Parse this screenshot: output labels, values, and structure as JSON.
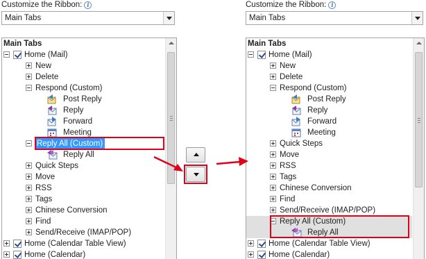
{
  "left_panel": {
    "caption": "Customize the Ribbon:",
    "info_glyph": "i",
    "combo_value": "Main Tabs",
    "list_header": "Main Tabs",
    "rows": [
      {
        "label": "Home (Mail)",
        "kind": "tab",
        "expander": "minus",
        "checked": true
      },
      {
        "label": "New",
        "kind": "group",
        "expander": "plus"
      },
      {
        "label": "Delete",
        "kind": "group",
        "expander": "plus"
      },
      {
        "label": "Respond (Custom)",
        "kind": "group",
        "expander": "minus"
      },
      {
        "label": "Post Reply",
        "kind": "command",
        "icon": "post-reply-icon"
      },
      {
        "label": "Reply",
        "kind": "command",
        "icon": "reply-icon"
      },
      {
        "label": "Forward",
        "kind": "command",
        "icon": "forward-icon"
      },
      {
        "label": "Meeting",
        "kind": "command",
        "icon": "meeting-icon"
      },
      {
        "label": "Reply All (Custom)",
        "kind": "group",
        "expander": "minus",
        "state": "selected"
      },
      {
        "label": "Reply All",
        "kind": "command",
        "icon": "reply-all-icon"
      },
      {
        "label": "Quick Steps",
        "kind": "group",
        "expander": "plus"
      },
      {
        "label": "Move",
        "kind": "group",
        "expander": "plus"
      },
      {
        "label": "RSS",
        "kind": "group",
        "expander": "plus"
      },
      {
        "label": "Tags",
        "kind": "group",
        "expander": "plus"
      },
      {
        "label": "Chinese Conversion",
        "kind": "group",
        "expander": "plus"
      },
      {
        "label": "Find",
        "kind": "group",
        "expander": "plus"
      },
      {
        "label": "Send/Receive (IMAP/POP)",
        "kind": "group",
        "expander": "plus"
      },
      {
        "label": "Home (Calendar Table View)",
        "kind": "tab",
        "expander": "plus",
        "checked": true
      },
      {
        "label": "Home (Calendar)",
        "kind": "tab",
        "expander": "plus",
        "checked": true
      }
    ]
  },
  "right_panel": {
    "caption": "Customize the Ribbon:",
    "info_glyph": "i",
    "combo_value": "Main Tabs",
    "list_header": "Main Tabs",
    "rows": [
      {
        "label": "Home (Mail)",
        "kind": "tab",
        "expander": "minus",
        "checked": true
      },
      {
        "label": "New",
        "kind": "group",
        "expander": "plus"
      },
      {
        "label": "Delete",
        "kind": "group",
        "expander": "plus"
      },
      {
        "label": "Respond (Custom)",
        "kind": "group",
        "expander": "minus"
      },
      {
        "label": "Post Reply",
        "kind": "command",
        "icon": "post-reply-icon"
      },
      {
        "label": "Reply",
        "kind": "command",
        "icon": "reply-icon"
      },
      {
        "label": "Forward",
        "kind": "command",
        "icon": "forward-icon"
      },
      {
        "label": "Meeting",
        "kind": "command",
        "icon": "meeting-icon"
      },
      {
        "label": "Quick Steps",
        "kind": "group",
        "expander": "plus"
      },
      {
        "label": "Move",
        "kind": "group",
        "expander": "plus"
      },
      {
        "label": "RSS",
        "kind": "group",
        "expander": "plus"
      },
      {
        "label": "Tags",
        "kind": "group",
        "expander": "plus"
      },
      {
        "label": "Chinese Conversion",
        "kind": "group",
        "expander": "plus"
      },
      {
        "label": "Find",
        "kind": "group",
        "expander": "plus"
      },
      {
        "label": "Send/Receive (IMAP/POP)",
        "kind": "group",
        "expander": "plus"
      },
      {
        "label": "Reply All (Custom)",
        "kind": "group",
        "expander": "minus",
        "state": "highlighted"
      },
      {
        "label": "Reply All",
        "kind": "command",
        "icon": "reply-all-icon",
        "state": "highlighted"
      },
      {
        "label": "Home (Calendar Table View)",
        "kind": "tab",
        "expander": "plus",
        "checked": true
      },
      {
        "label": "Home (Calendar)",
        "kind": "tab",
        "expander": "plus",
        "checked": true
      }
    ]
  },
  "move_buttons": {
    "up": "move-up",
    "down": "move-down"
  },
  "colors": {
    "selection": "#3399ff",
    "highlight": "#e0e0e0",
    "annotation": "#e1001a"
  }
}
